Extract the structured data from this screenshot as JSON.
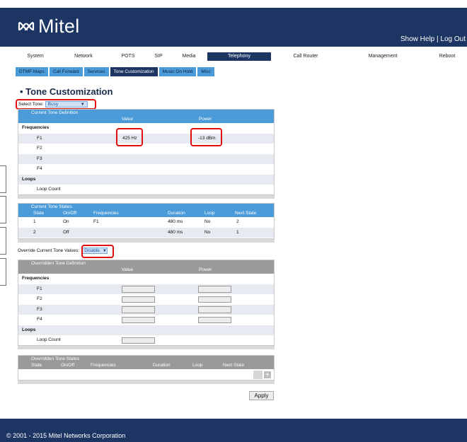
{
  "brand": {
    "name": "Mitel",
    "logo_icon": "mitel-infinity-logo",
    "color_header": "#1c3563",
    "color_accent": "#4a9bd8",
    "highlight_color": "#e01010"
  },
  "header": {
    "show_help": "Show Help",
    "separator": "|",
    "log_out": "Log Out"
  },
  "main_nav": [
    {
      "label": "System",
      "active": false
    },
    {
      "label": "Network",
      "active": false
    },
    {
      "label": "POTS",
      "active": false
    },
    {
      "label": "SIP",
      "active": false
    },
    {
      "label": "Media",
      "active": false
    },
    {
      "label": "Telephony",
      "active": true
    },
    {
      "label": "Call Router",
      "active": false
    },
    {
      "label": "Management",
      "active": false
    },
    {
      "label": "Reboot",
      "active": false
    }
  ],
  "sub_nav": [
    {
      "label": "DTMF Maps",
      "active": false
    },
    {
      "label": "Call Forward",
      "active": false
    },
    {
      "label": "Services",
      "active": false
    },
    {
      "label": "Tone Customization",
      "active": true
    },
    {
      "label": "Music On Hold",
      "active": false
    },
    {
      "label": "Misc",
      "active": false
    }
  ],
  "page": {
    "title": "• Tone Customization"
  },
  "select_tone": {
    "label": "Select Tone:",
    "value": "Busy",
    "arrow": "▼"
  },
  "current_def": {
    "title": "Current Tone Definition",
    "col_value": "Value",
    "col_power": "Power",
    "frequencies_label": "Frequencies",
    "rows": [
      {
        "name": "F1",
        "value": "425 Hz",
        "power": "-13 dBm"
      },
      {
        "name": "F2",
        "value": "",
        "power": ""
      },
      {
        "name": "F3",
        "value": "",
        "power": ""
      },
      {
        "name": "F4",
        "value": "",
        "power": ""
      }
    ],
    "loops_label": "Loops",
    "loop_count_label": "Loop Count",
    "loop_count_value": ""
  },
  "current_states": {
    "title": "Current Tone States",
    "headers": [
      "State",
      "On/Off",
      "Frequencies",
      "Duration",
      "Loop",
      "Next State"
    ],
    "rows": [
      [
        "1",
        "On",
        "F1",
        "480 ms",
        "No",
        "2"
      ],
      [
        "2",
        "Off",
        "",
        "480 ms",
        "No",
        "1"
      ]
    ]
  },
  "override": {
    "label": "Override Current Tone Values:",
    "value": "Disable",
    "arrow": "▼"
  },
  "overridden_def": {
    "title": "Overridden Tone Definition",
    "col_value": "Value",
    "col_power": "Power",
    "frequencies_label": "Frequencies",
    "rows": [
      {
        "name": "F1",
        "value": "",
        "power": ""
      },
      {
        "name": "F2",
        "value": "",
        "power": ""
      },
      {
        "name": "F3",
        "value": "",
        "power": ""
      },
      {
        "name": "F4",
        "value": "",
        "power": ""
      }
    ],
    "loops_label": "Loops",
    "loop_count_label": "Loop Count",
    "loop_count_value": ""
  },
  "overridden_states": {
    "title": "Overridden Tone States",
    "headers": [
      "State",
      "On/Off",
      "Frequencies",
      "Duration",
      "Loop",
      "Next State"
    ],
    "add_icon": "plus-icon",
    "add_glyph": "+"
  },
  "apply_label": "Apply",
  "footer": {
    "copyright": "© 2001 - 2015 Mitel Networks Corporation"
  }
}
